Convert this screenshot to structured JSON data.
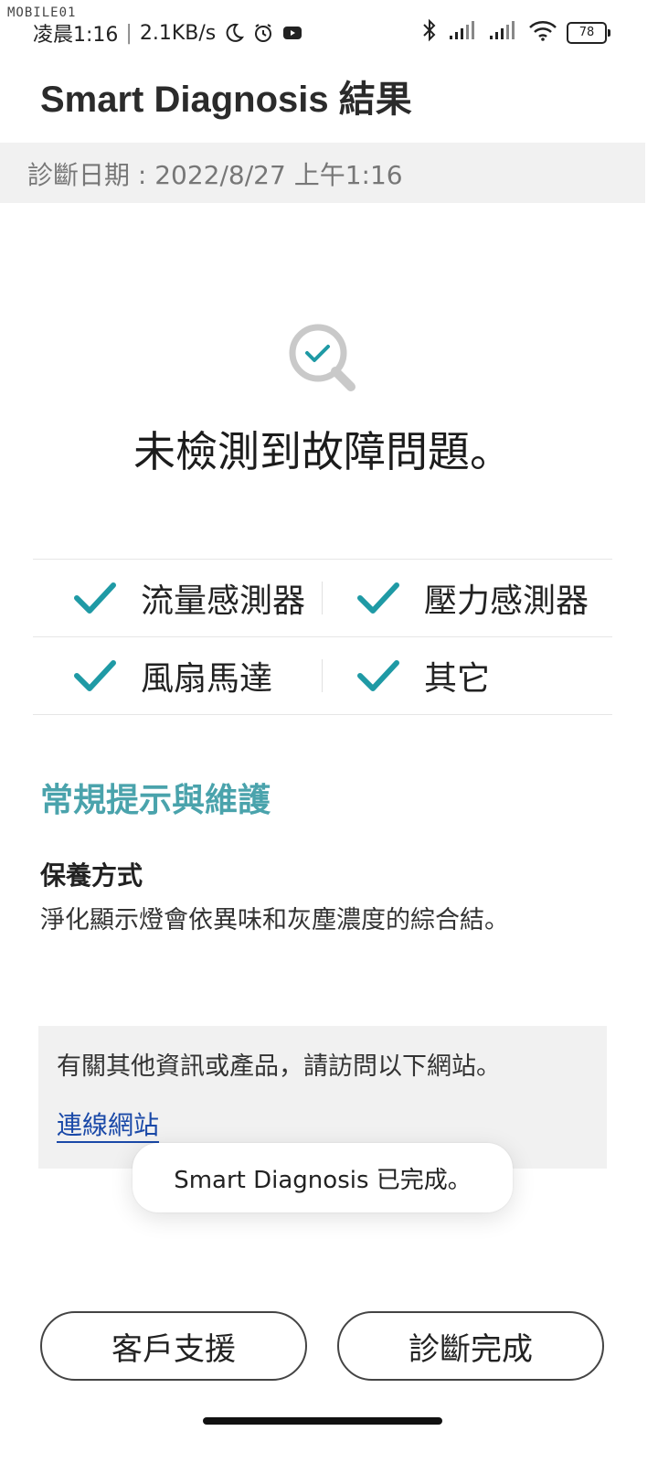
{
  "status_bar": {
    "watermark": "MOBILE01",
    "time": "凌晨1:16",
    "net_speed": "2.1KB/s",
    "battery": "78",
    "icons": [
      "moon-icon",
      "alarm-icon",
      "youtube-icon",
      "bluetooth-icon",
      "signal-icon",
      "signal-icon",
      "wifi-icon",
      "battery-icon"
    ]
  },
  "header": {
    "title": "Smart Diagnosis 結果"
  },
  "diagnosis_date": "診斷日期 : 2022/8/27 上午1:16",
  "result": {
    "icon": "magnifier-check-icon",
    "message": "未檢測到故障問題。"
  },
  "checks": {
    "items": [
      {
        "label": "流量感測器",
        "status": "ok"
      },
      {
        "label": "壓力感測器",
        "status": "ok"
      },
      {
        "label": "風扇馬達",
        "status": "ok"
      },
      {
        "label": "其它",
        "status": "ok"
      }
    ]
  },
  "tips": {
    "title": "常規提示與維護",
    "care_title": "保養方式",
    "care_text": "淨化顯示燈會依異味和灰塵濃度的綜合結。"
  },
  "info": {
    "text": "有關其他資訊或產品，請訪問以下網站。",
    "link_label": "連線網站"
  },
  "toast": {
    "message": "Smart Diagnosis 已完成。"
  },
  "buttons": {
    "support": "客戶支援",
    "done": "診斷完成"
  },
  "colors": {
    "accent": "#4aa3ac",
    "check": "#1f9aa5",
    "link": "#1a49a8"
  }
}
